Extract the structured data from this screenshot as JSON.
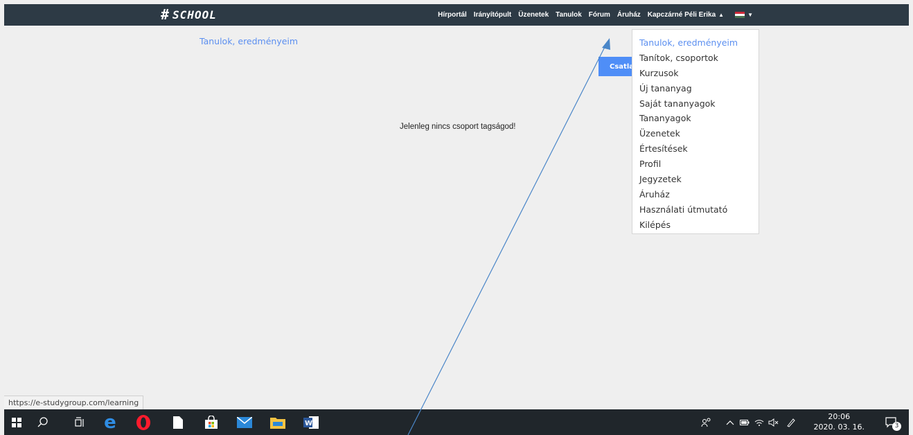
{
  "header": {
    "logo_mark": "#",
    "logo_text": "SCHOOL",
    "nav_items": [
      "Hírportál",
      "Irányítópult",
      "Üzenetek",
      "Tanulok",
      "Fórum",
      "Áruház"
    ],
    "user_name": "Kapczárné Péli Erika",
    "user_caret": "▲",
    "lang_caret": "▼"
  },
  "subnav": {
    "label": "Tanulok, eredményeim"
  },
  "join_button": {
    "label": "Csatlakozás"
  },
  "main": {
    "empty_message": "Jelenleg nincs csoport tagságod!"
  },
  "user_menu": {
    "items": [
      "Tanulok, eredményeim",
      "Tanítok, csoportok",
      "Kurzusok",
      "Új tananyag",
      "Saját tananyagok",
      "Tananyagok",
      "Üzenetek",
      "Értesítések",
      "Profil",
      "Jegyzetek",
      "Áruház",
      "Használati útmutató",
      "Kilépés"
    ],
    "active_index": 0
  },
  "status_bar": {
    "url": "https://e-studygroup.com/learning"
  },
  "taskbar": {
    "clock_time": "20:06",
    "clock_date": "2020. 03. 16.",
    "notification_count": "3"
  },
  "colors": {
    "header_bg": "#2d3a45",
    "accent": "#5b8ff0",
    "button_bg": "#4f8ef7",
    "annotation_arrow": "#4a86c8"
  }
}
